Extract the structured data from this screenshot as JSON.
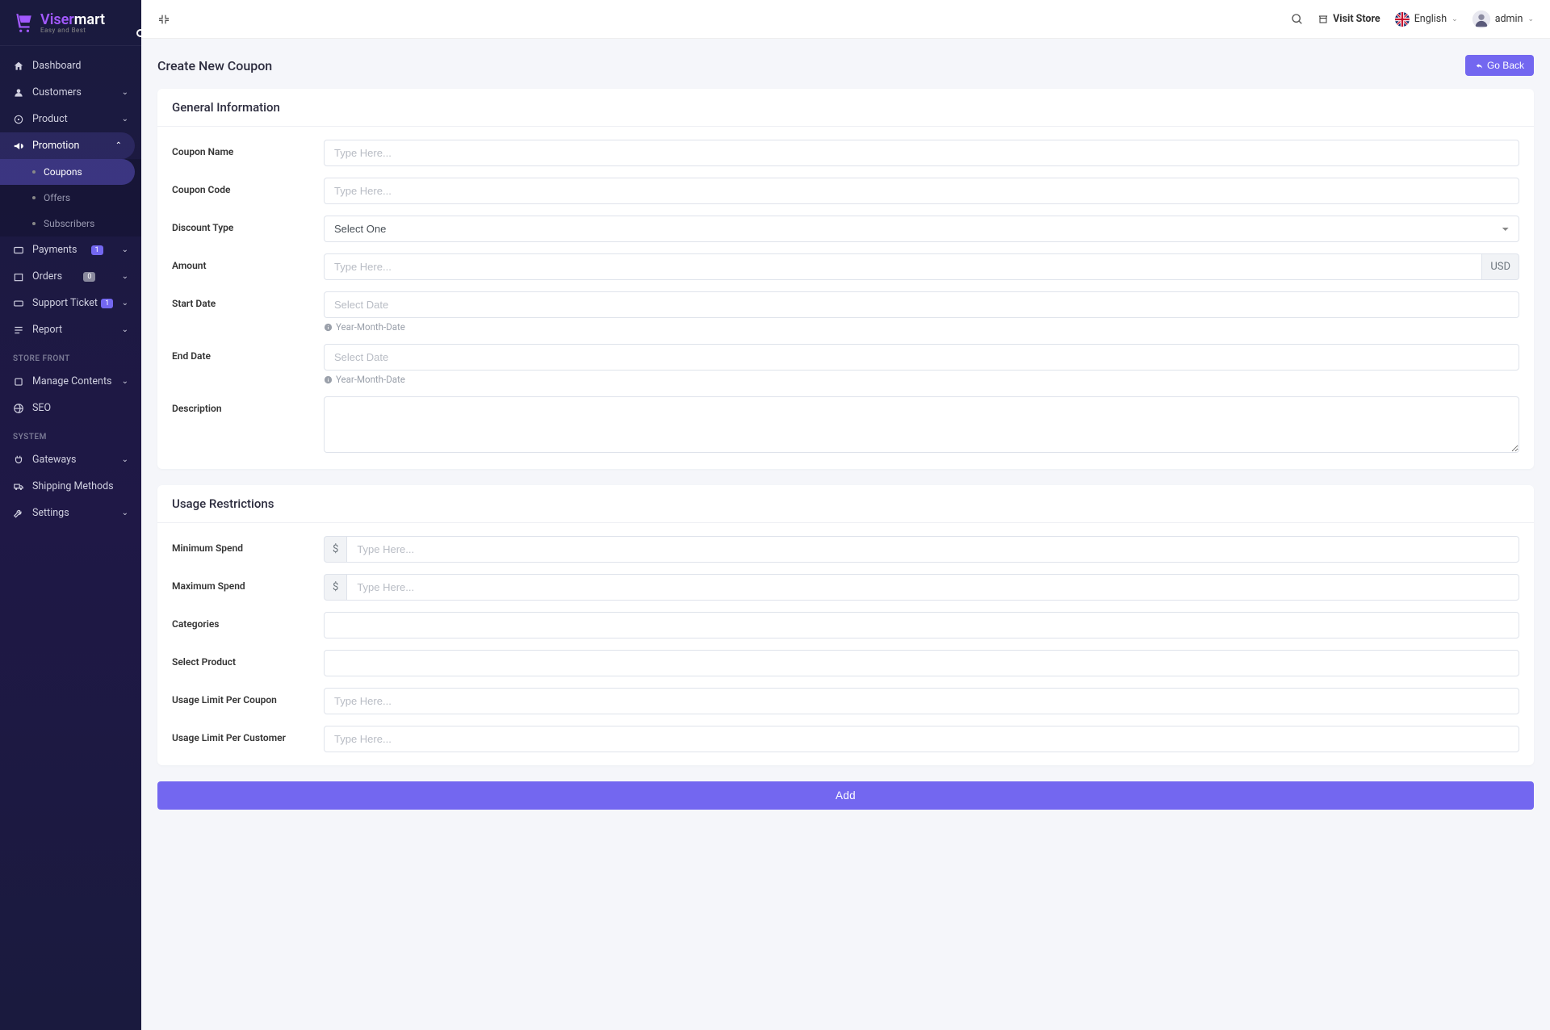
{
  "brand": {
    "name1": "Viser",
    "name2": "mart",
    "tagline": "Easy and Best"
  },
  "topbar": {
    "visit_store": "Visit Store",
    "language": "English",
    "user": "admin"
  },
  "sidebar": {
    "items": {
      "dashboard": "Dashboard",
      "customers": "Customers",
      "product": "Product",
      "promotion": "Promotion",
      "coupons": "Coupons",
      "offers": "Offers",
      "subscribers": "Subscribers",
      "payments": "Payments",
      "payments_badge": "1",
      "orders": "Orders",
      "orders_badge": "0",
      "support": "Support Ticket",
      "support_badge": "1",
      "report": "Report",
      "header_storefront": "STORE FRONT",
      "manage_contents": "Manage Contents",
      "seo": "SEO",
      "header_system": "SYSTEM",
      "gateways": "Gateways",
      "shipping": "Shipping Methods",
      "settings": "Settings"
    }
  },
  "page": {
    "title": "Create New Coupon",
    "go_back": "Go Back",
    "section1_title": "General Information",
    "section2_title": "Usage Restrictions",
    "submit": "Add"
  },
  "form": {
    "coupon_name": {
      "label": "Coupon Name",
      "placeholder": "Type Here..."
    },
    "coupon_code": {
      "label": "Coupon Code",
      "placeholder": "Type Here..."
    },
    "discount_type": {
      "label": "Discount Type",
      "select_one": "Select One"
    },
    "amount": {
      "label": "Amount",
      "placeholder": "Type Here...",
      "addon": "USD"
    },
    "start_date": {
      "label": "Start Date",
      "placeholder": "Select Date",
      "hint": "Year-Month-Date"
    },
    "end_date": {
      "label": "End Date",
      "placeholder": "Select Date",
      "hint": "Year-Month-Date"
    },
    "description": {
      "label": "Description"
    },
    "min_spend": {
      "label": "Minimum Spend",
      "placeholder": "Type Here...",
      "addon": "$"
    },
    "max_spend": {
      "label": "Maximum Spend",
      "placeholder": "Type Here...",
      "addon": "$"
    },
    "categories": {
      "label": "Categories"
    },
    "select_product": {
      "label": "Select Product"
    },
    "usage_limit_coupon": {
      "label": "Usage Limit Per Coupon",
      "placeholder": "Type Here..."
    },
    "usage_limit_customer": {
      "label": "Usage Limit Per Customer",
      "placeholder": "Type Here..."
    }
  }
}
